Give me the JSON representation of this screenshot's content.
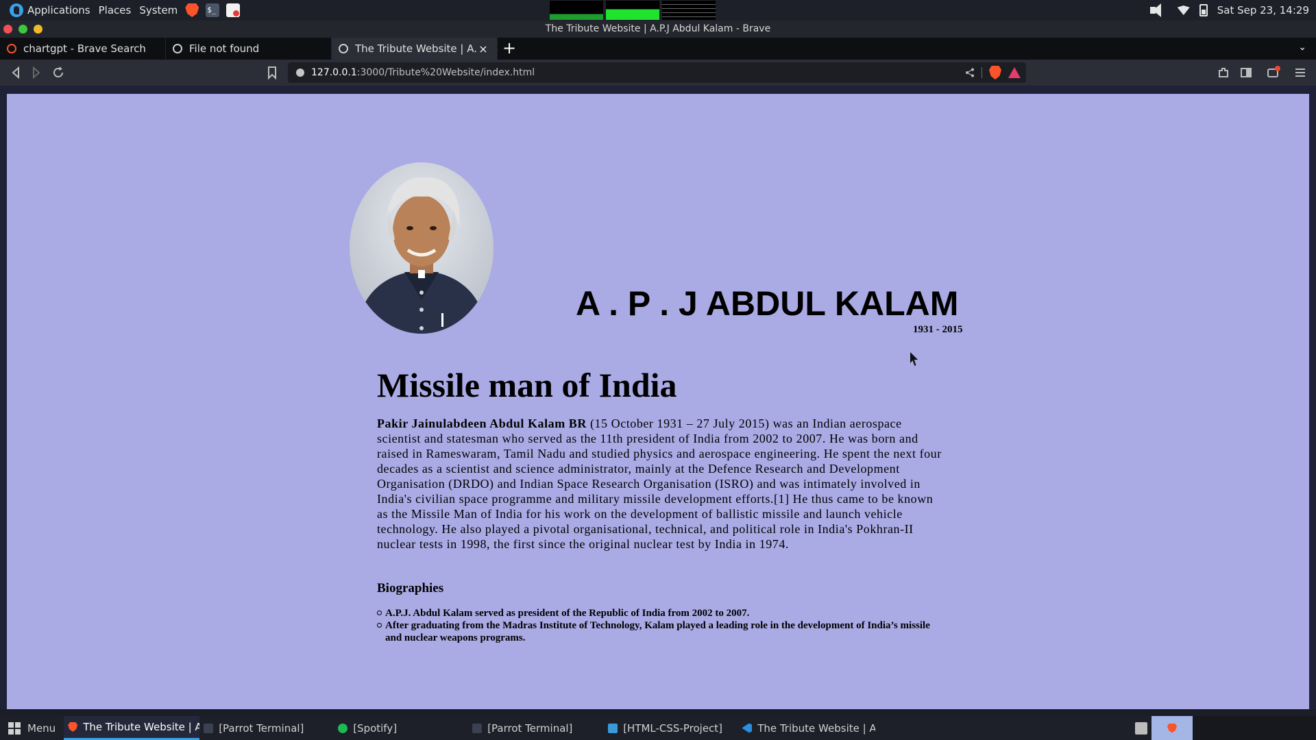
{
  "top_panel": {
    "applications": "Applications",
    "places": "Places",
    "system": "System",
    "terminal_icon_text": "$_",
    "clock": "Sat Sep 23, 14:29"
  },
  "window": {
    "title": "The Tribute Website | A.P.J Abdul Kalam - Brave"
  },
  "tabs": [
    {
      "label": "chartgpt - Brave Search",
      "icon": "brave-search-icon"
    },
    {
      "label": "File not found",
      "icon": "globe-icon"
    },
    {
      "label": "The Tribute Website | A.P.J Abdul Kalam",
      "icon": "globe-icon",
      "active": true
    }
  ],
  "tab_close_glyph": "×",
  "new_tab_glyph": "+",
  "tab_list_glyph": "⌄",
  "toolbar": {
    "url_host": "127.0.0.1",
    "url_path": ":3000/Tribute%20Website/index.html"
  },
  "page": {
    "name": "A . P . J ABDUL KALAM",
    "years": "1931 - 2015",
    "headline": "Missile man of India",
    "intro_bold": "Pakir Jainulabdeen Abdul Kalam BR",
    "intro_text": " (15 October 1931 – 27 July 2015) was an Indian aerospace scientist and statesman who served as the 11th president of India from 2002 to 2007. He was born and raised in Rameswaram, Tamil Nadu and studied physics and aerospace engineering. He spent the next four decades as a scientist and science administrator, mainly at the Defence Research and Development Organisation (DRDO) and Indian Space Research Organisation (ISRO) and was intimately involved in India's civilian space programme and military missile development efforts.[1] He thus came to be known as the Missile Man of India for his work on the development of ballistic missile and launch vehicle technology. He also played a pivotal organisational, technical, and political role in India's Pokhran-II nuclear tests in 1998, the first since the original nuclear test by India in 1974.",
    "bio_title": "Biographies",
    "bio_items": [
      "A.P.J. Abdul Kalam served as president of the Republic of India from 2002 to 2007.",
      "After graduating from the Madras Institute of Technology, Kalam played a leading role in the development of India’s missile and nuclear weapons programs."
    ],
    "background_color": "#aaaae5"
  },
  "taskbar": {
    "menu": "Menu",
    "tasks": [
      {
        "label": "The Tribute Website | A...",
        "icon": "brave-icon",
        "active": true
      },
      {
        "label": "[Parrot Terminal]",
        "icon": "terminal-icon"
      },
      {
        "label": "[Spotify]",
        "icon": "spotify-icon"
      },
      {
        "label": "[Parrot Terminal]",
        "icon": "terminal-icon"
      },
      {
        "label": "[HTML-CSS-Project]",
        "icon": "folder-icon"
      },
      {
        "label": "The Tribute Website | A...",
        "icon": "vscode-icon"
      }
    ]
  }
}
